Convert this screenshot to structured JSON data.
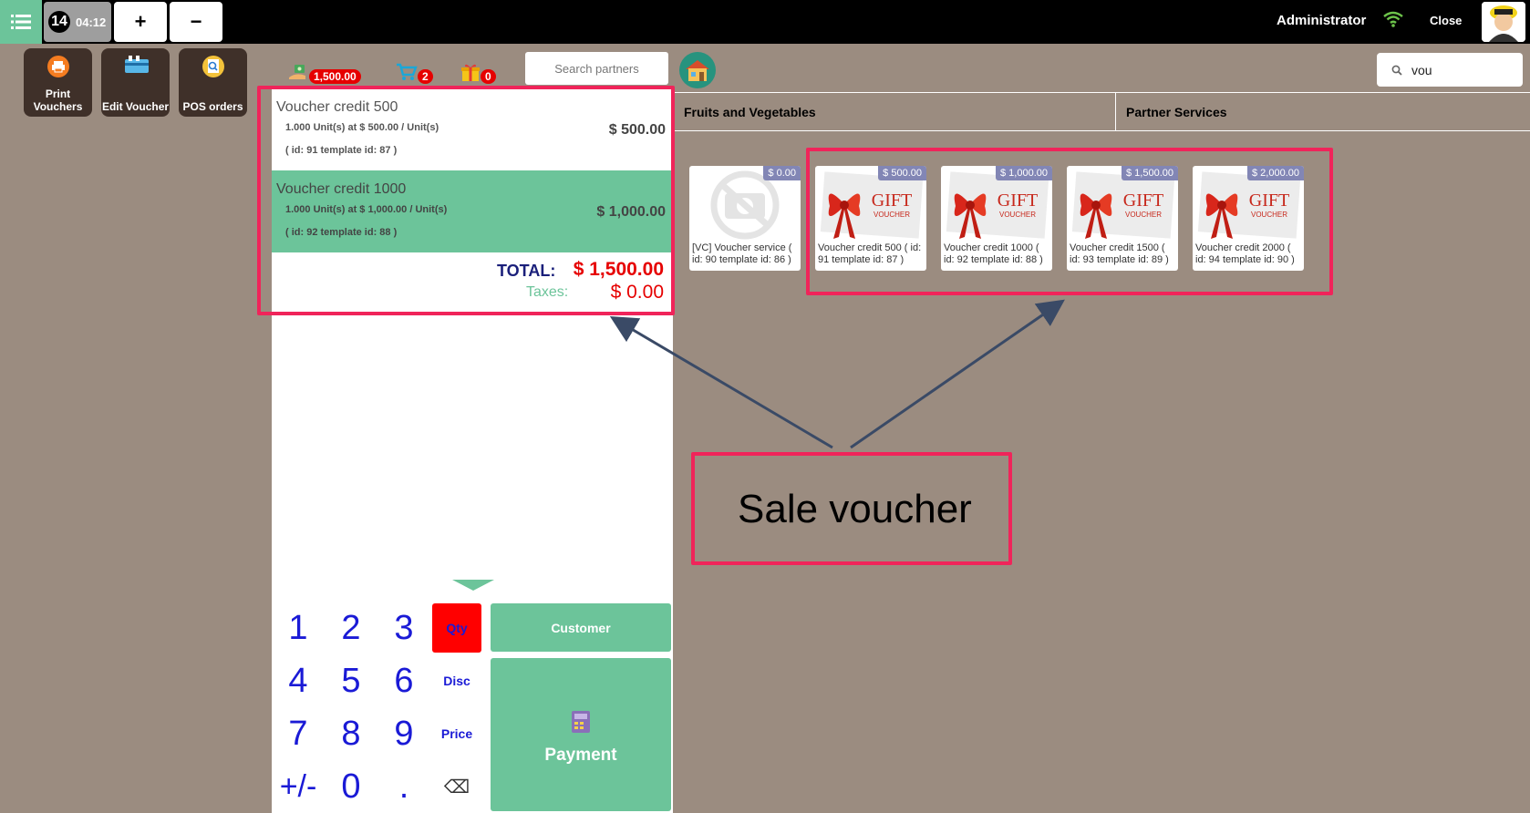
{
  "topbar": {
    "order_number": "14",
    "order_time": "04:12",
    "add_order": "+",
    "remove_order": "−",
    "user": "Administrator",
    "close": "Close"
  },
  "actions": [
    {
      "label_line1": "Print",
      "label_line2": "Vouchers"
    },
    {
      "label_line1": "Edit Voucher"
    },
    {
      "label_line1": "POS orders"
    }
  ],
  "header": {
    "credit_badge": "1,500.00",
    "cart_badge": "2",
    "gift_badge": "0",
    "search_partners_placeholder": "Search partners",
    "search_products_value": "vou"
  },
  "order": {
    "lines": [
      {
        "name": "Voucher credit 500",
        "qty_text": "1.000 Unit(s) at $ 500.00 / Unit(s)",
        "ids": "( id: 91 template id: 87 )",
        "price": "$ 500.00",
        "selected": false
      },
      {
        "name": "Voucher credit 1000",
        "qty_text": "1.000 Unit(s) at $ 1,000.00 / Unit(s)",
        "ids": "( id: 92 template id: 88 )",
        "price": "$ 1,000.00",
        "selected": true
      }
    ],
    "total_label": "TOTAL:",
    "total_value": "$ 1,500.00",
    "taxes_label": "Taxes:",
    "taxes_value": "$ 0.00"
  },
  "numpad": {
    "keys": [
      "1",
      "2",
      "3",
      "4",
      "5",
      "6",
      "7",
      "8",
      "9",
      "+/-",
      "0",
      "."
    ],
    "modes": [
      "Qty",
      "Disc",
      "Price"
    ],
    "backspace": "⌫",
    "customer": "Customer",
    "payment": "Payment"
  },
  "categories": [
    "Fruits and Vegetables",
    "Partner Services"
  ],
  "products": [
    {
      "name": "[VC] Voucher service ( id: 90 template id: 86 )",
      "price": "$ 0.00",
      "image": "no-image"
    },
    {
      "name": "Voucher credit 500 ( id: 91 template id: 87 )",
      "price": "$ 500.00",
      "image": "gift-voucher"
    },
    {
      "name": "Voucher credit 1000 ( id: 92 template id: 88 )",
      "price": "$ 1,000.00",
      "image": "gift-voucher"
    },
    {
      "name": "Voucher credit 1500 ( id: 93 template id: 89 )",
      "price": "$ 1,500.00",
      "image": "gift-voucher"
    },
    {
      "name": "Voucher credit 2000 ( id: 94 template id: 90 )",
      "price": "$ 2,000.00",
      "image": "gift-voucher"
    }
  ],
  "annotation": {
    "label": "Sale voucher",
    "color": "#f0245a"
  },
  "colors": {
    "accent": "#6cc49a",
    "background": "#9b8c80",
    "total_red": "#e60000",
    "numpad_blue": "#1a1ad6"
  }
}
